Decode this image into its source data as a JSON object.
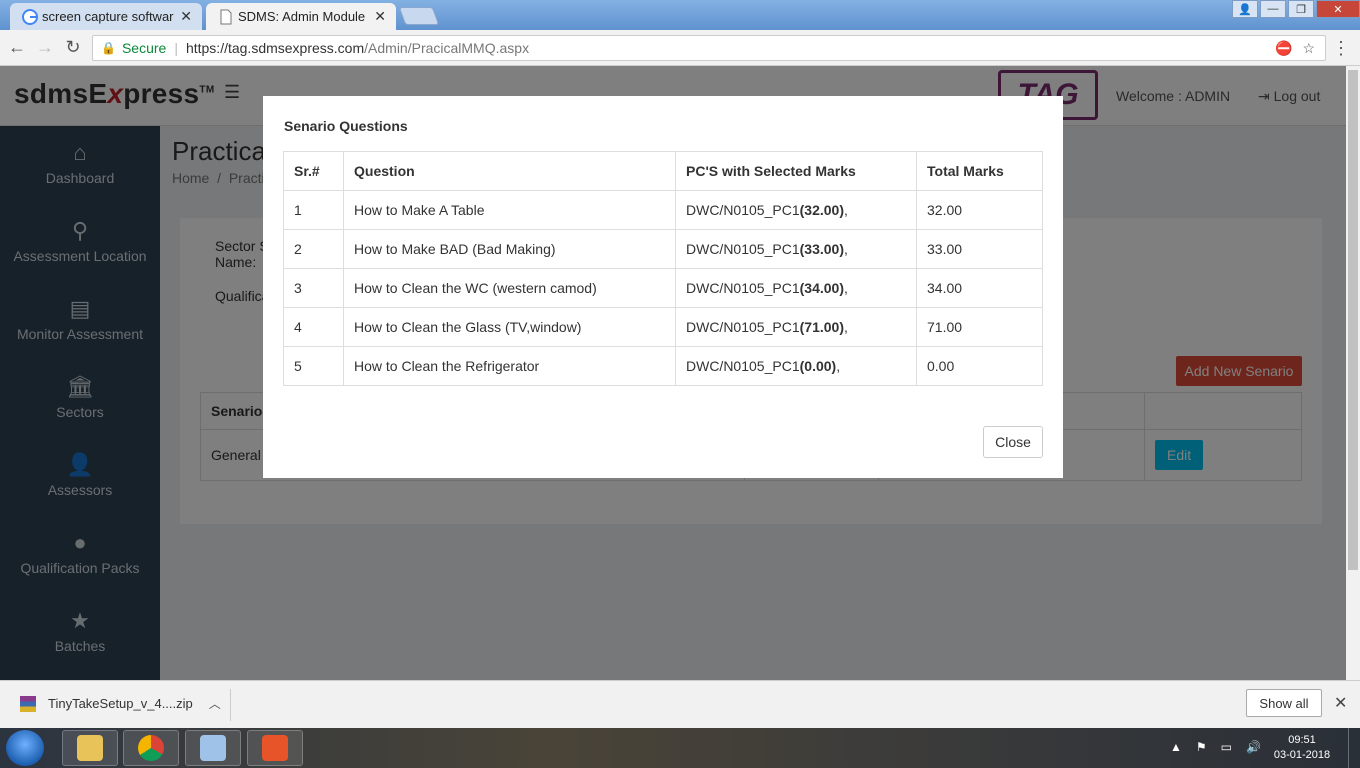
{
  "browser": {
    "tabs": [
      {
        "label": "screen capture software"
      },
      {
        "label": "SDMS: Admin Module"
      }
    ],
    "secure_label": "Secure",
    "url_host": "https://tag.sdmsexpress.com",
    "url_path": "/Admin/PracicalMMQ.aspx"
  },
  "header": {
    "brand_prefix": "sdmsE",
    "brand_x": "x",
    "brand_suffix": "press",
    "brand_tm": "TM",
    "logo_text": "TAG",
    "welcome": "Welcome : ADMIN",
    "logout": "Log out"
  },
  "sidebar": {
    "items": [
      {
        "label": "Dashboard",
        "icon": "home-icon"
      },
      {
        "label": "Assessment Location",
        "icon": "map-pin-icon"
      },
      {
        "label": "Monitor Assessment",
        "icon": "list-icon"
      },
      {
        "label": "Sectors",
        "icon": "bank-icon"
      },
      {
        "label": "Assessors",
        "icon": "user-icon"
      },
      {
        "label": "Qualification Packs",
        "icon": "globe-icon"
      },
      {
        "label": "Batches",
        "icon": "star-icon"
      }
    ]
  },
  "content": {
    "title": "Practical",
    "breadcrumb_home": "Home",
    "breadcrumb_current": "Practic",
    "sector_label_line1": "Sector S",
    "sector_label_line2": "Name:",
    "qualification_label": "Qualifica",
    "add_button": "Add New Senario",
    "table_header_first": "Senario",
    "row_first_cell": "General I",
    "edit_button": "Edit"
  },
  "modal": {
    "title": "Senario Questions",
    "columns": [
      "Sr.#",
      "Question",
      "PC'S with Selected Marks",
      "Total Marks"
    ],
    "rows": [
      {
        "sr": "1",
        "question": "How to Make A Table",
        "pc": "DWC/N0105_PC1",
        "marks": "32.00",
        "total": "32.00"
      },
      {
        "sr": "2",
        "question": "How to Make BAD (Bad Making)",
        "pc": "DWC/N0105_PC1",
        "marks": "33.00",
        "total": "33.00"
      },
      {
        "sr": "3",
        "question": "How to Clean the WC (western camod)",
        "pc": "DWC/N0105_PC1",
        "marks": "34.00",
        "total": "34.00"
      },
      {
        "sr": "4",
        "question": "How to Clean the Glass (TV,window)",
        "pc": "DWC/N0105_PC1",
        "marks": "71.00",
        "total": "71.00"
      },
      {
        "sr": "5",
        "question": "How to Clean the Refrigerator",
        "pc": "DWC/N0105_PC1",
        "marks": "0.00",
        "total": "0.00"
      }
    ],
    "close_button": "Close"
  },
  "downloads": {
    "file": "TinyTakeSetup_v_4....zip",
    "show_all": "Show all"
  },
  "taskbar": {
    "time": "09:51",
    "date": "03-01-2018"
  },
  "colors": {
    "sidebar_bg": "#2f4354",
    "add_button": "#dd4b39",
    "edit_button": "#00c0ef",
    "brand_accent": "#c0202a",
    "logo": "#7a2a6e"
  }
}
